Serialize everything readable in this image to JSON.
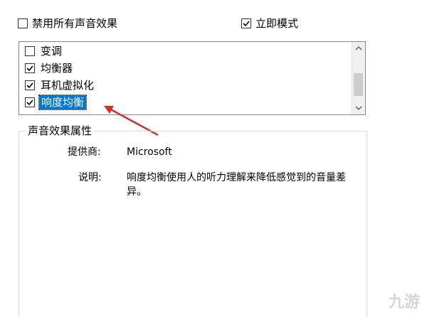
{
  "top": {
    "disable_all": {
      "label": "禁用所有声音效果",
      "checked": false
    },
    "immediate_mode": {
      "label": "立即模式",
      "checked": true
    }
  },
  "effects": {
    "items": [
      {
        "label": "变调",
        "checked": false,
        "selected": false
      },
      {
        "label": "均衡器",
        "checked": true,
        "selected": false
      },
      {
        "label": "耳机虚拟化",
        "checked": true,
        "selected": false
      },
      {
        "label": "响度均衡",
        "checked": true,
        "selected": true
      }
    ]
  },
  "properties": {
    "title": "声音效果属性",
    "provider_label": "提供商:",
    "provider_value": "Microsoft",
    "description_label": "说明:",
    "description_value": "响度均衡使用人的听力理解来降低感觉到的音量差异。"
  },
  "watermark": "九游",
  "colors": {
    "selection": "#0078d7",
    "annotation_arrow": "#d32f2f",
    "border": "#828790"
  },
  "icons": {
    "check": "check-icon",
    "scroll_up": "chevron-up-icon",
    "scroll_down": "chevron-down-icon"
  }
}
